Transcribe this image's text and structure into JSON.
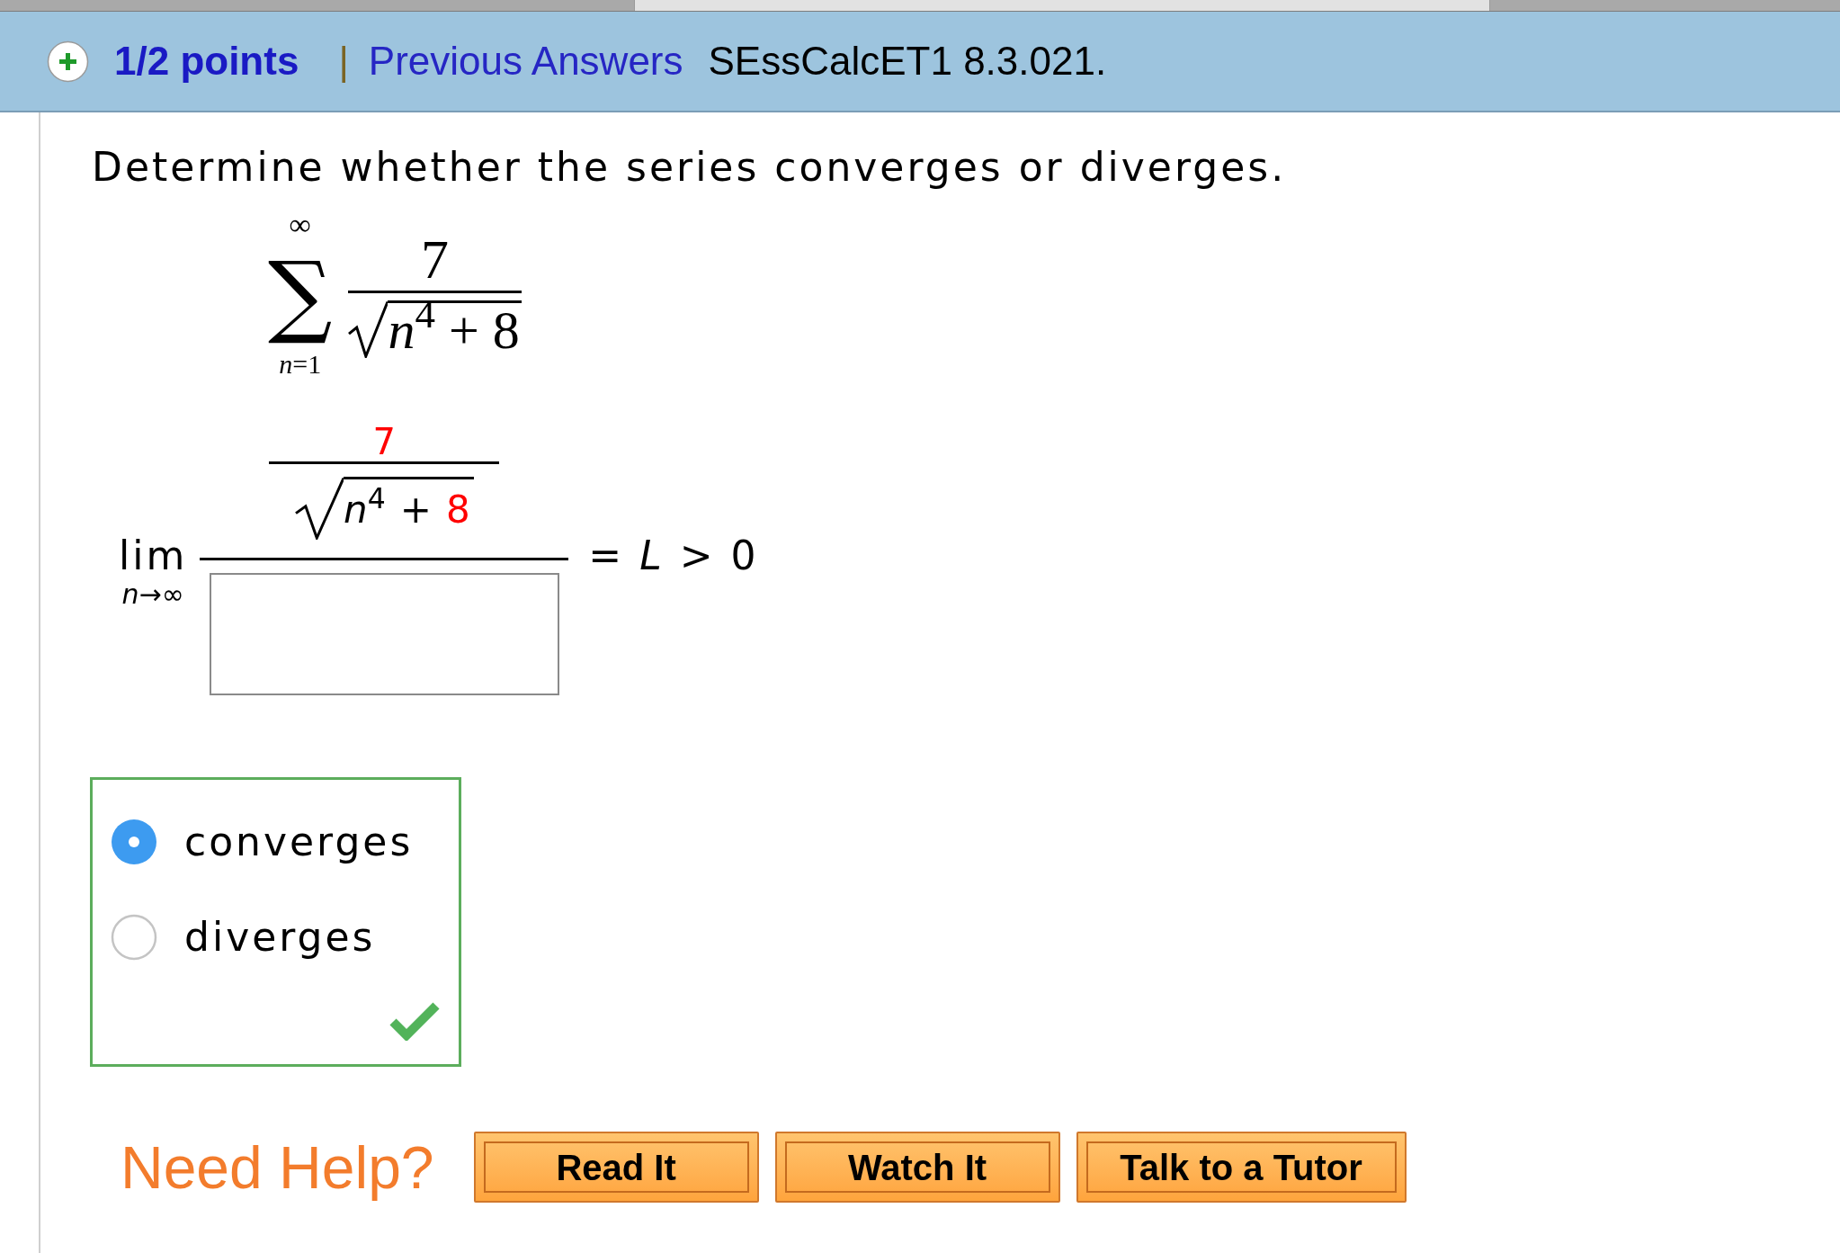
{
  "header": {
    "score": "1/2 points",
    "separator": "|",
    "previous_answers": "Previous Answers",
    "problem_id": "SEssCalcET1 8.3.021."
  },
  "question": "Determine whether the series converges or diverges.",
  "series": {
    "operator": "∑",
    "upper": "∞",
    "lower": "*n*=1",
    "numerator": "7",
    "radicand": "*n*$^{4}$ + 8"
  },
  "limit": {
    "operator": "lim",
    "subscript": "*n*→∞",
    "numerator_terms": [
      {
        "text": "7",
        "color": "#ff0000"
      }
    ],
    "radicand_terms": [
      {
        "text": "*n*$^{4}$",
        "color": "#000000"
      },
      {
        "text": "+",
        "color": "#000000"
      },
      {
        "text": "8",
        "color": "#ff0000"
      }
    ],
    "result": "= *L* > 0"
  },
  "choices": {
    "correct": true,
    "options": [
      {
        "label": "converges",
        "selected": true
      },
      {
        "label": "diverges",
        "selected": false
      }
    ]
  },
  "help": {
    "title": "Need Help?",
    "buttons": [
      "Read It",
      "Watch It",
      "Talk to a Tutor"
    ]
  }
}
